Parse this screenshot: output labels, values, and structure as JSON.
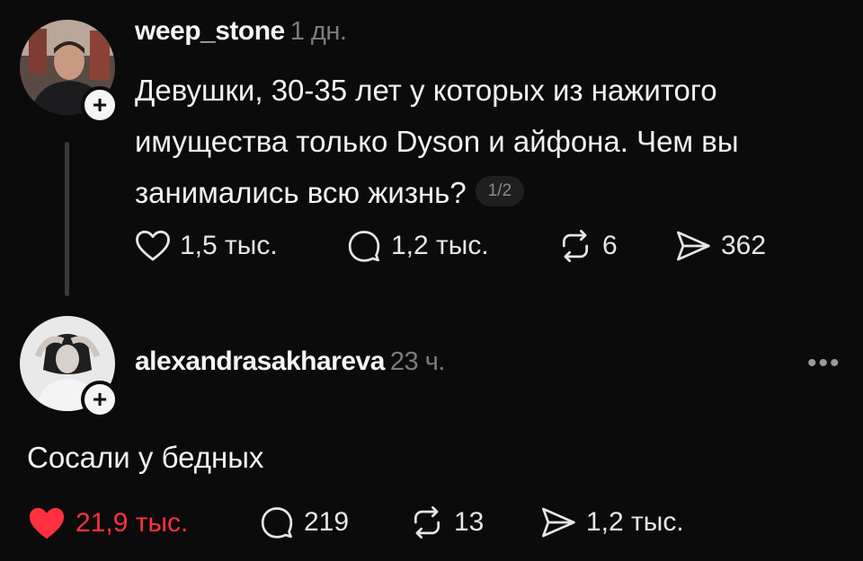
{
  "post1": {
    "username": "weep_stone",
    "time": "1 дн.",
    "text_line1": "Девушки,  30-35 лет у которых из нажитого",
    "text_line2": "имущества только Dyson и  айфона. Чем вы",
    "text_line3": "занимались всю жизнь?",
    "page_indicator": "1/2",
    "likes": "1,5 тыс.",
    "replies": "1,2 тыс.",
    "reposts": "6",
    "shares": "362",
    "like_icon": "heart-outline-icon",
    "reply_icon": "comment-icon",
    "repost_icon": "repost-icon",
    "share_icon": "send-icon"
  },
  "post2": {
    "username": "alexandrasakhareva",
    "time": "23 ч.",
    "text": "Сосали у бедных",
    "likes": "21,9 тыс.",
    "replies": "219",
    "reposts": "13",
    "shares": "1,2 тыс.",
    "like_icon": "heart-filled-icon",
    "more_icon": "more-dots-icon"
  },
  "colors": {
    "background": "#0b0b0b",
    "text": "#f3f3f3",
    "muted": "#7c7c7c",
    "liked": "#ff3040"
  },
  "more_label": "•••",
  "plus_label": "+"
}
